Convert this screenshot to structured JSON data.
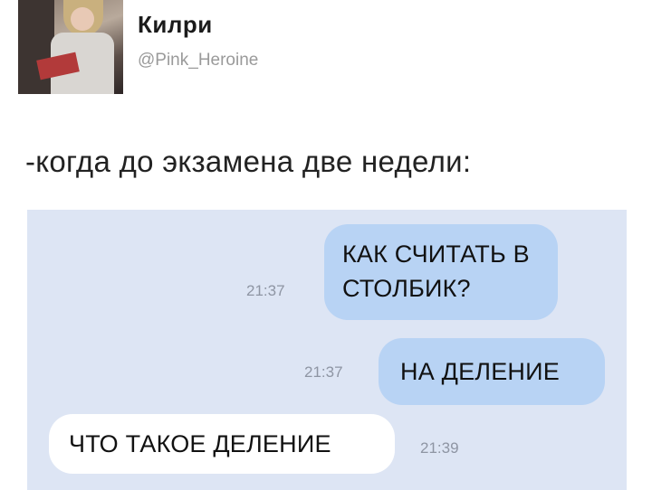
{
  "profile": {
    "name": "Килри",
    "handle": "@Pink_Heroine",
    "avatar_icon": "profile-photo"
  },
  "tweet": {
    "text": "-когда до экзамена две недели:"
  },
  "chat": {
    "background": "#dde5f4",
    "outgoing_color": "#b8d3f4",
    "incoming_color": "#ffffff",
    "messages": [
      {
        "direction": "out",
        "text": "КАК СЧИТАТЬ В СТОЛБИК?",
        "time": "21:37"
      },
      {
        "direction": "out",
        "text": "НА ДЕЛЕНИЕ",
        "time": "21:37"
      },
      {
        "direction": "in",
        "text": "ЧТО ТАКОЕ ДЕЛЕНИЕ",
        "time": "21:39"
      }
    ]
  }
}
